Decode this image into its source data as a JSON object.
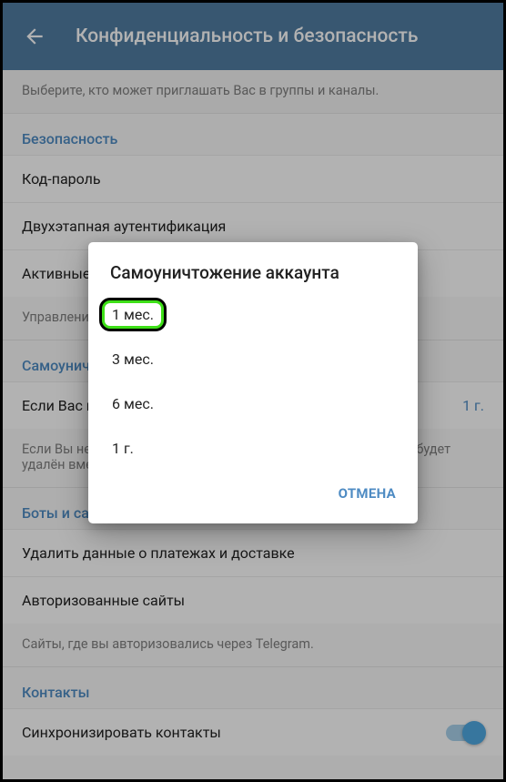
{
  "appbar": {
    "title": "Конфиденциальность и безопасность"
  },
  "groups_desc": "Выберите, кто может приглашать Вас в группы и каналы.",
  "security": {
    "header": "Безопасность",
    "passcode": "Код-пароль",
    "two_step": "Двухэтапная аутентификация",
    "active_sessions": "Активные сеансы",
    "sessions_desc": "Управление сеансами на всех ваших устройствах."
  },
  "self_destruct": {
    "header": "Самоуничтожение аккаунта",
    "if_away_label": "Если Вас нет",
    "if_away_value": "1 г.",
    "desc": "Если Вы не зайдёте в сеть ни разу за этот период, Ваш аккаунт будет удалён вместе со всеми сообщениями, группами и контактами."
  },
  "bots": {
    "header": "Боты и сайты",
    "clear_payments": "Удалить данные о платежах и доставке",
    "authorized_sites": "Авторизованные сайты",
    "sites_desc": "Сайты, где вы авторизовались через Telegram."
  },
  "contacts": {
    "header": "Контакты",
    "sync": "Синхронизировать контакты"
  },
  "dialog": {
    "title": "Самоуничтожение аккаунта",
    "options": [
      "1 мес.",
      "3 мес.",
      "6 мес.",
      "1 г."
    ],
    "cancel": "ОТМЕНА"
  }
}
